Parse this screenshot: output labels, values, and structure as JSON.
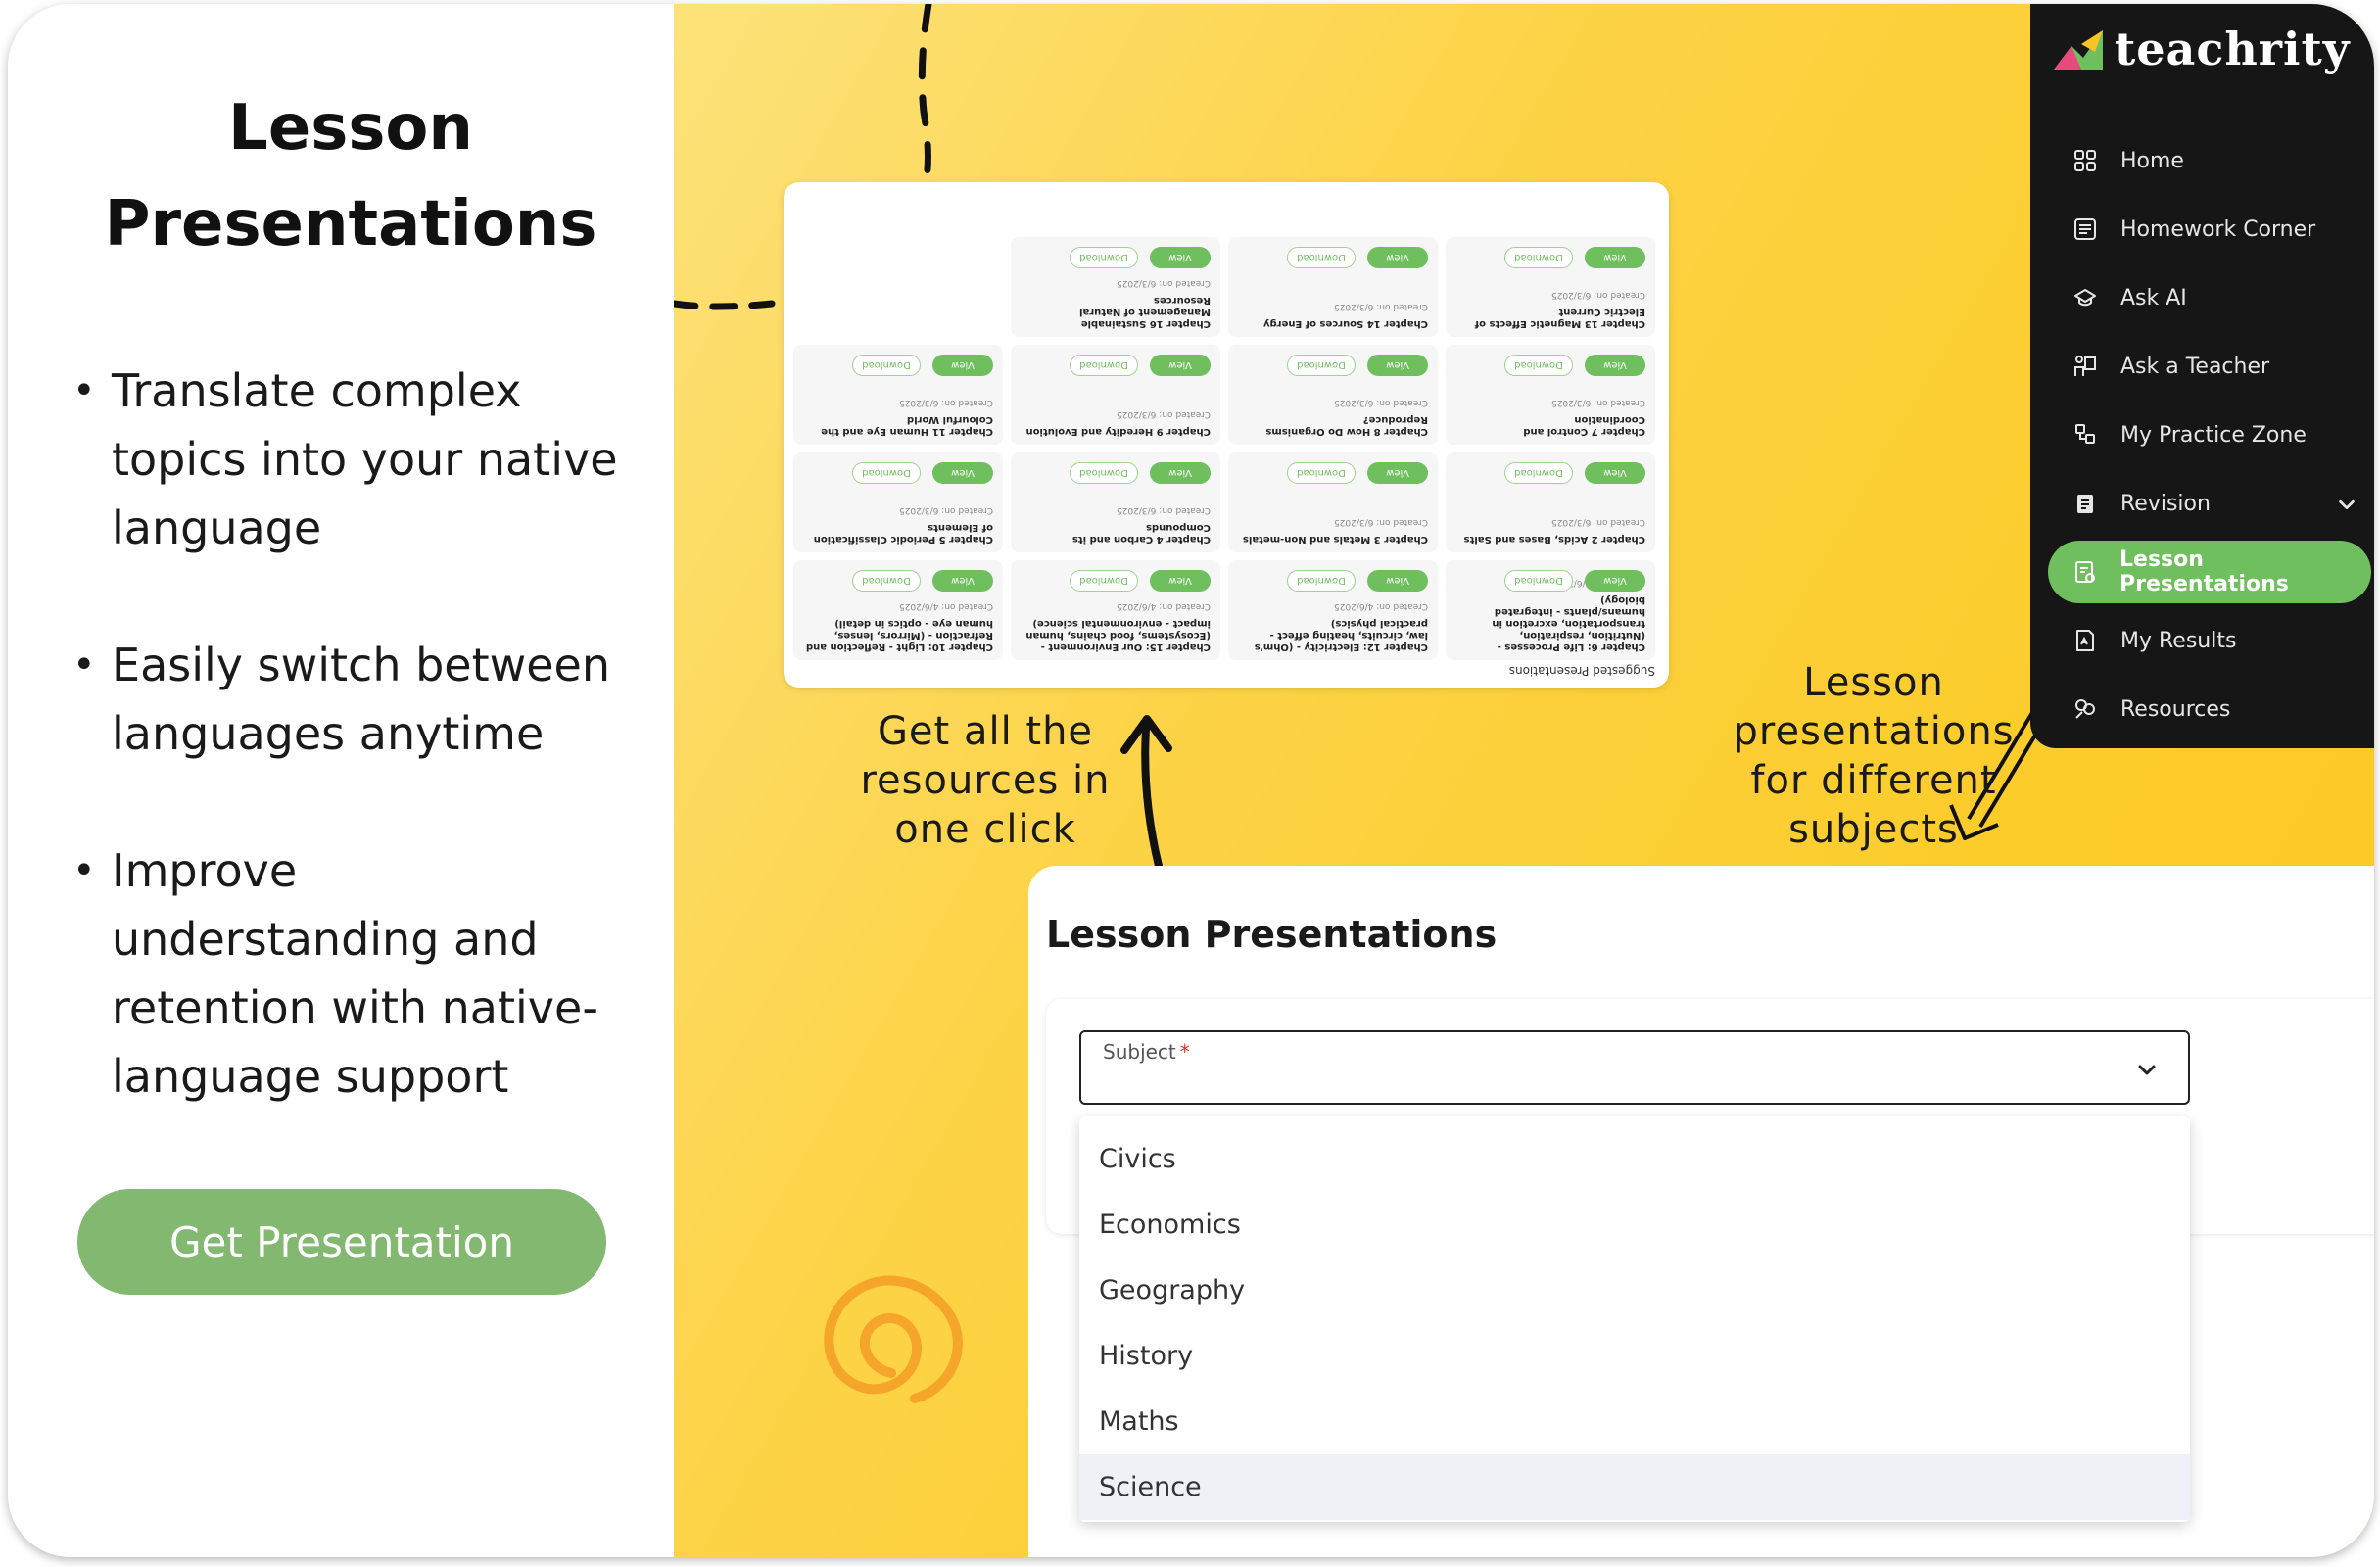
{
  "headline": "Lesson Presentations",
  "features": [
    "Translate complex topics into your native language",
    "Easily switch between languages anytime",
    "Improve understanding and retention with native-language support"
  ],
  "cta_label": "Get Presentation",
  "suggested": {
    "title": "Suggested Presentations",
    "view_label": "View",
    "download_label": "Download",
    "tiles": [
      {
        "name": "Chapter 6: Life Processes - (Nutrition, respiration, transportation, excretion in humans/plants - integrated biology)",
        "date": "Created on: 4/6/2025"
      },
      {
        "name": "Chapter 12: Electricity - (Ohm's law, circuits, heating effect - practical physics)",
        "date": "Created on: 4/6/2025"
      },
      {
        "name": "Chapter 15: Our Environment - (Ecosystems, food chains, human impact - environmental science)",
        "date": "Created on: 4/6/2025"
      },
      {
        "name": "Chapter 10: Light - Reflection and Refraction - (Mirrors, lenses, human eye - optics in detail)",
        "date": "Created on: 4/6/2025"
      },
      {
        "name": "Chapter 2 Acids, Bases and Salts",
        "date": "Created on: 6/3/2025"
      },
      {
        "name": "Chapter 3 Metals and Non-metals",
        "date": "Created on: 6/3/2025"
      },
      {
        "name": "Chapter 4 Carbon and its Compounds",
        "date": "Created on: 6/3/2025"
      },
      {
        "name": "Chapter 5 Periodic Classification of Elements",
        "date": "Created on: 6/3/2025"
      },
      {
        "name": "Chapter 7 Control and Coordination",
        "date": "Created on: 6/3/2025"
      },
      {
        "name": "Chapter 8 How Do Organisms Reproduce?",
        "date": "Created on: 6/3/2025"
      },
      {
        "name": "Chapter 9 Heredity and Evolution",
        "date": "Created on: 6/3/2025"
      },
      {
        "name": "Chapter 11 Human Eye and the Colourful World",
        "date": "Created on: 6/3/2025"
      },
      {
        "name": "Chapter 13 Magnetic Effects of Electric Current",
        "date": "Created on: 6/3/2025"
      },
      {
        "name": "Chapter 14 Sources of Energy",
        "date": "Created on: 6/3/2025"
      },
      {
        "name": "Chapter 16 Sustainable Management of Natural Resources",
        "date": "Created on: 6/3/2025"
      }
    ]
  },
  "captions": {
    "resources": "Get all the resources in one click",
    "subjects": "Lesson presentations for different subjects"
  },
  "sidebar": {
    "brand": "teachrity",
    "items": [
      {
        "label": "Home",
        "icon": "home-grid-icon"
      },
      {
        "label": "Homework Corner",
        "icon": "homework-icon"
      },
      {
        "label": "Ask AI",
        "icon": "ask-ai-icon"
      },
      {
        "label": "Ask a Teacher",
        "icon": "teacher-icon"
      },
      {
        "label": "My Practice Zone",
        "icon": "practice-icon"
      },
      {
        "label": "Revision",
        "icon": "revision-icon"
      },
      {
        "label": "Lesson Presentations",
        "icon": "presentation-icon"
      },
      {
        "label": "My Results",
        "icon": "results-icon"
      },
      {
        "label": "Resources",
        "icon": "resources-icon"
      }
    ],
    "active": "Lesson Presentations"
  },
  "lesson_panel": {
    "title": "Lesson Presentations",
    "subject_label": "Subject",
    "required_mark": "*",
    "options": [
      "Civics",
      "Economics",
      "Geography",
      "History",
      "Maths",
      "Science"
    ],
    "highlighted_option": "Science"
  },
  "colors": {
    "brand_green": "#82b86f",
    "active_green": "#6fbf5e",
    "yellow": "#fcce2e",
    "sidebar_bg": "#161616"
  }
}
